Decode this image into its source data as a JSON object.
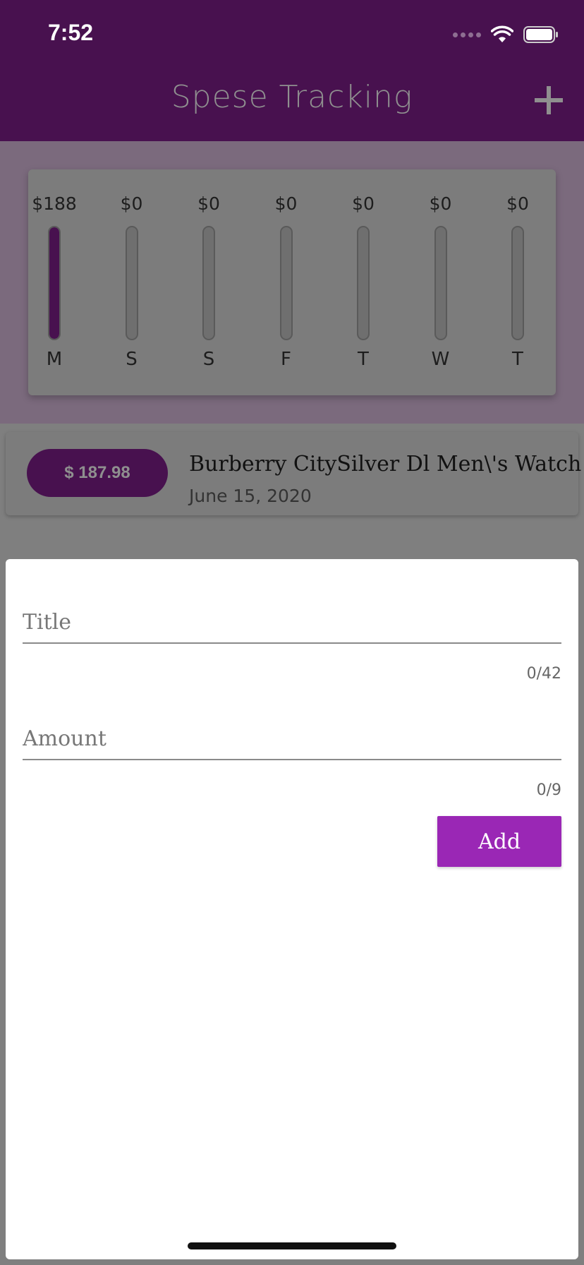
{
  "status_bar": {
    "time": "7:52"
  },
  "app_bar": {
    "title": "Spese Tracking",
    "add_icon": "plus-icon"
  },
  "chart_data": {
    "type": "bar",
    "categories": [
      "M",
      "S",
      "S",
      "F",
      "T",
      "W",
      "T"
    ],
    "value_labels": [
      "$188",
      "$0",
      "$0",
      "$0",
      "$0",
      "$0",
      "$0"
    ],
    "values": [
      188,
      0,
      0,
      0,
      0,
      0,
      0
    ],
    "fill_fraction": [
      1,
      0,
      0,
      0,
      0,
      0,
      0
    ],
    "bar_color": "#48114f"
  },
  "transactions": [
    {
      "amount": "$ 187.98",
      "title": "Burberry CitySilver Dl Men\\'s Watch",
      "date": "June 15, 2020"
    }
  ],
  "form": {
    "title_placeholder": "Title",
    "title_counter": "0/42",
    "amount_placeholder": "Amount",
    "amount_counter": "0/9",
    "add_label": "Add"
  },
  "colors": {
    "primary": "#48114f",
    "accent": "#9a27b5"
  }
}
